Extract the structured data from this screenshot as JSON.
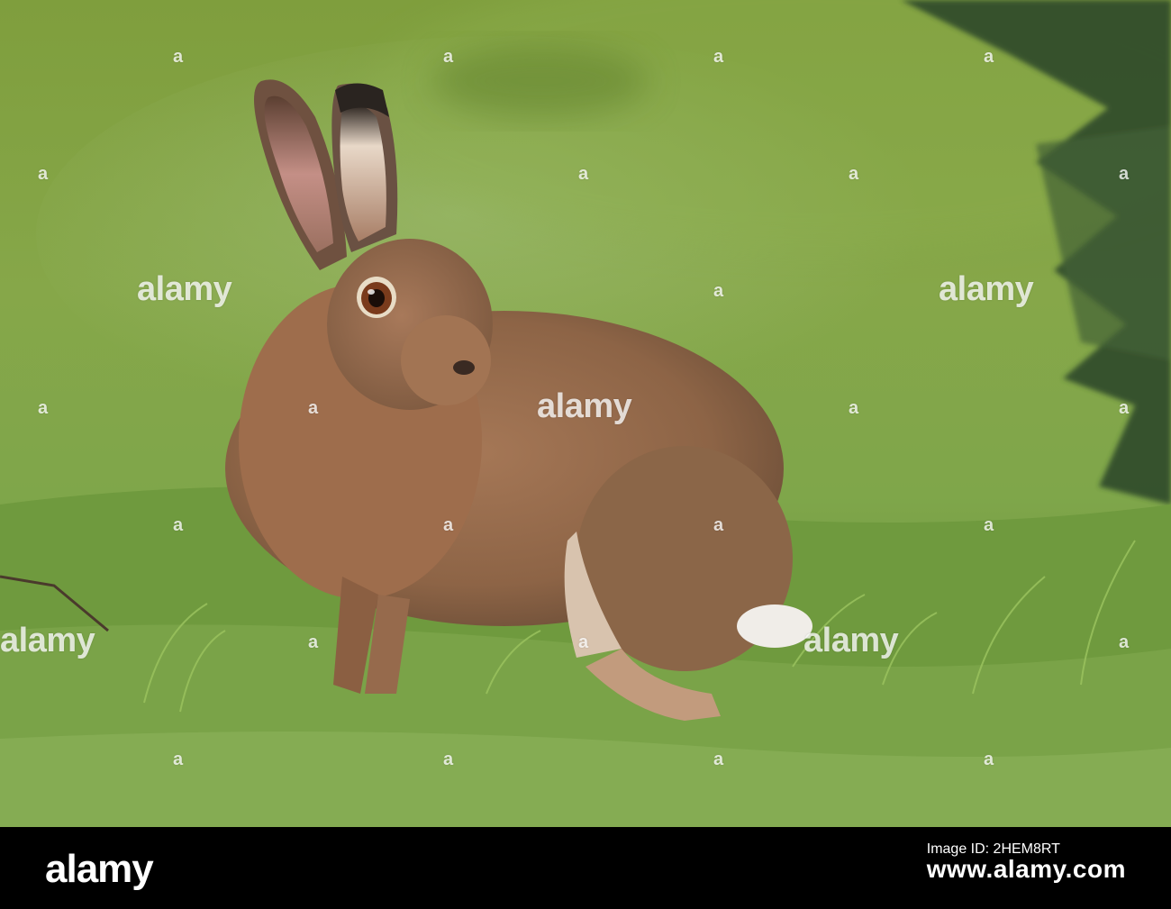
{
  "watermark": {
    "text": "alamy",
    "mark": "a"
  },
  "footer": {
    "logo": "alamy",
    "image_id_label": "Image ID: 2HEM8RT",
    "site": "www.alamy.com"
  },
  "colors": {
    "grass": "#6f9a3e",
    "background": "#86a94a",
    "hare": "#9a6a48",
    "footer": "#000000"
  }
}
